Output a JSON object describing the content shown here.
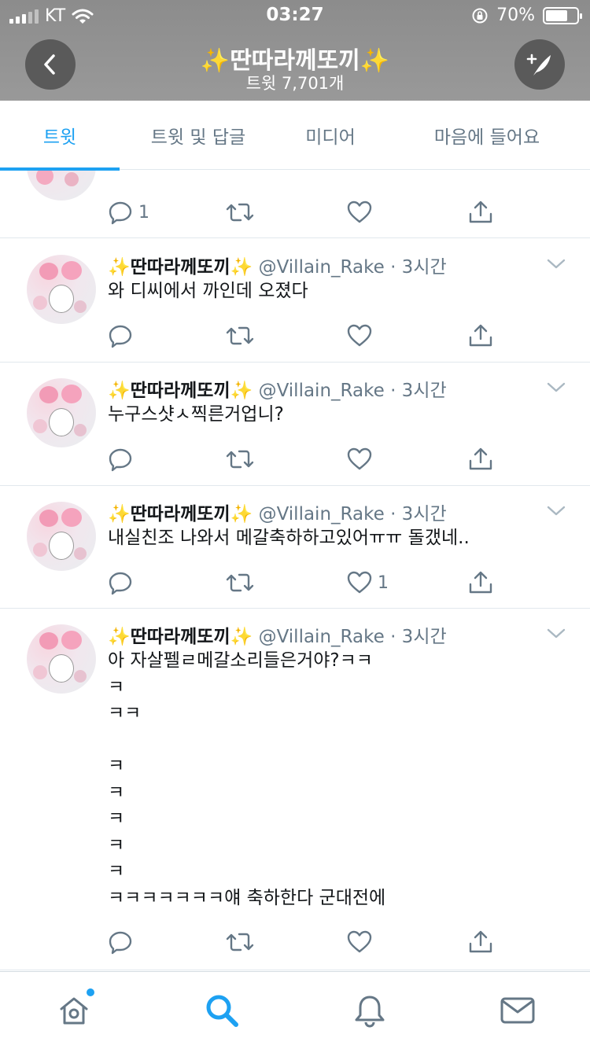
{
  "status_bar": {
    "carrier": "KT",
    "time": "03:27",
    "battery": "70%"
  },
  "header": {
    "title": "딴따라께또끼",
    "title_emoji": "✨",
    "subtitle": "트윗 7,701개"
  },
  "tabs": [
    {
      "label": "트윗",
      "active": true
    },
    {
      "label": "트윗 및 답글",
      "active": false
    },
    {
      "label": "미디어",
      "active": false
    },
    {
      "label": "마음에 들어요",
      "active": false
    }
  ],
  "partial_tweet": {
    "reply_count": "1"
  },
  "tweets": [
    {
      "name": "딴따라께또끼",
      "handle": "@Villain_Rake",
      "time": "· 3시간",
      "text": "와 디씨에서 까인데 오졌다",
      "reply_count": "",
      "like_count": ""
    },
    {
      "name": "딴따라께또끼",
      "handle": "@Villain_Rake",
      "time": "· 3시간",
      "text": "누구스샷ㅅ찍른거업니?",
      "reply_count": "",
      "like_count": ""
    },
    {
      "name": "딴따라께또끼",
      "handle": "@Villain_Rake",
      "time": "· 3시간",
      "text": "내실친조 나와서 메갈축하하고있어ㅠㅠ 돌갰네..",
      "reply_count": "",
      "like_count": "1"
    },
    {
      "name": "딴따라께또끼",
      "handle": "@Villain_Rake",
      "time": "· 3시간",
      "text": "아 자살펠ㄹ메갈소리들은거야?ㅋㅋ\nㅋ\nㅋㅋ\n\nㅋ\nㅋ\nㅋ\nㅋ\nㅋ\nㅋㅋㅋㅋㅋㅋㅋ얘 축하한다 군대전에",
      "reply_count": "",
      "like_count": ""
    }
  ],
  "icons": {
    "back": "chevron-left-icon",
    "compose": "compose-tweet-icon",
    "reply": "reply-icon",
    "retweet": "retweet-icon",
    "like": "heart-icon",
    "share": "share-icon",
    "more": "chevron-down-icon",
    "home": "home-icon",
    "search": "search-icon",
    "notifications": "bell-icon",
    "messages": "envelope-icon"
  },
  "colors": {
    "accent": "#1da1f2",
    "header_bg": "#999999",
    "muted": "#657786"
  }
}
